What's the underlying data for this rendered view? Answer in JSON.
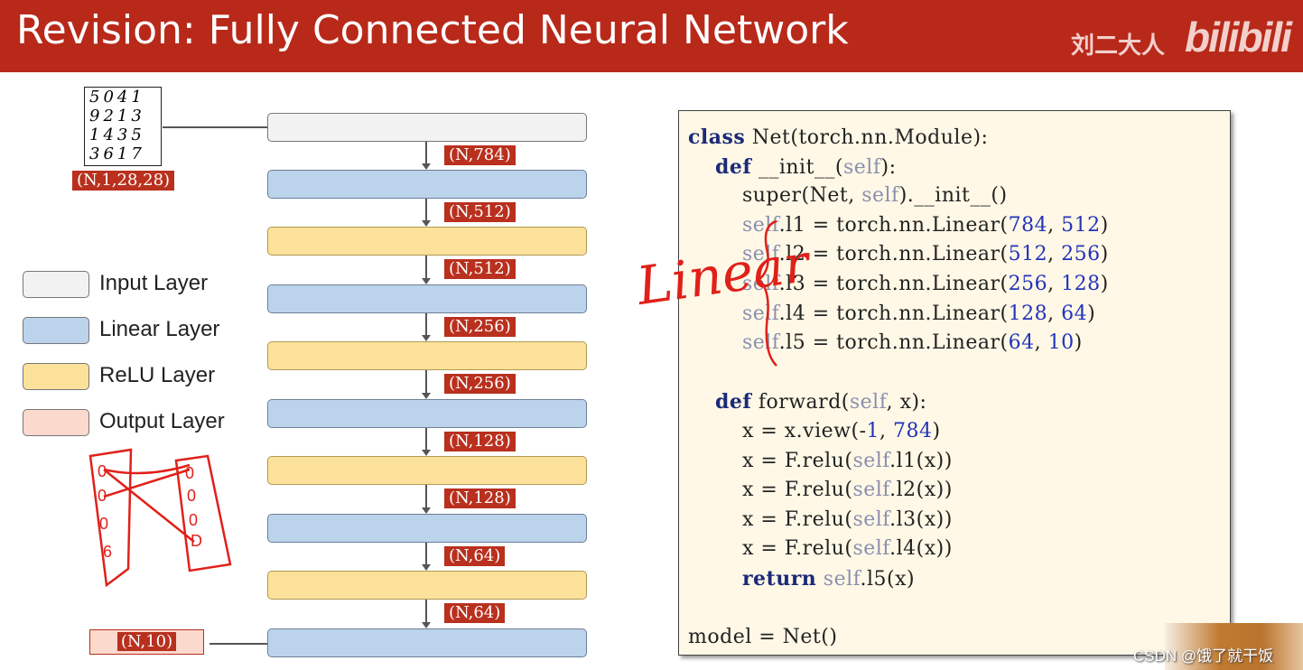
{
  "header": {
    "title": "Revision: Fully Connected Neural Network",
    "author": "刘二大人",
    "logo": "bilibili"
  },
  "input_image": {
    "rows": [
      "5041",
      "9213",
      "1435",
      "3617"
    ],
    "shape": "(N,1,28,28)"
  },
  "layers": [
    {
      "type": "input",
      "color": "#f2f2f2"
    },
    {
      "type": "linear",
      "color": "#bcd3ec"
    },
    {
      "type": "relu",
      "color": "#fbe19a"
    },
    {
      "type": "linear"
    },
    {
      "type": "relu"
    },
    {
      "type": "linear"
    },
    {
      "type": "relu"
    },
    {
      "type": "linear"
    },
    {
      "type": "relu"
    },
    {
      "type": "linear"
    }
  ],
  "shapes": [
    "(N,784)",
    "(N,512)",
    "(N,512)",
    "(N,256)",
    "(N,256)",
    "(N,128)",
    "(N,128)",
    "(N,64)",
    "(N,64)"
  ],
  "output_shape": "(N,10)",
  "legend": [
    {
      "label": "Input Layer",
      "color": "#f2f2f2"
    },
    {
      "label": "Linear Layer",
      "color": "#bcd3ec"
    },
    {
      "label": "ReLU Layer",
      "color": "#fbe19a"
    },
    {
      "label": "Output Layer",
      "color": "#fbd9cc"
    }
  ],
  "code": [
    "class Net(torch.nn.Module):",
    "    def __init__(self):",
    "        super(Net, self).__init__()",
    "        self.l1 = torch.nn.Linear(784, 512)",
    "        self.l2 = torch.nn.Linear(512, 256)",
    "        self.l3 = torch.nn.Linear(256, 128)",
    "        self.l4 = torch.nn.Linear(128, 64)",
    "        self.l5 = torch.nn.Linear(64, 10)",
    "",
    "    def forward(self, x):",
    "        x = x.view(-1, 784)",
    "        x = F.relu(self.l1(x))",
    "        x = F.relu(self.l2(x))",
    "        x = F.relu(self.l3(x))",
    "        x = F.relu(self.l4(x))",
    "        return self.l5(x)",
    "",
    "model = Net()"
  ],
  "annotation": "Linear",
  "watermark": "CSDN @饿了就干饭"
}
